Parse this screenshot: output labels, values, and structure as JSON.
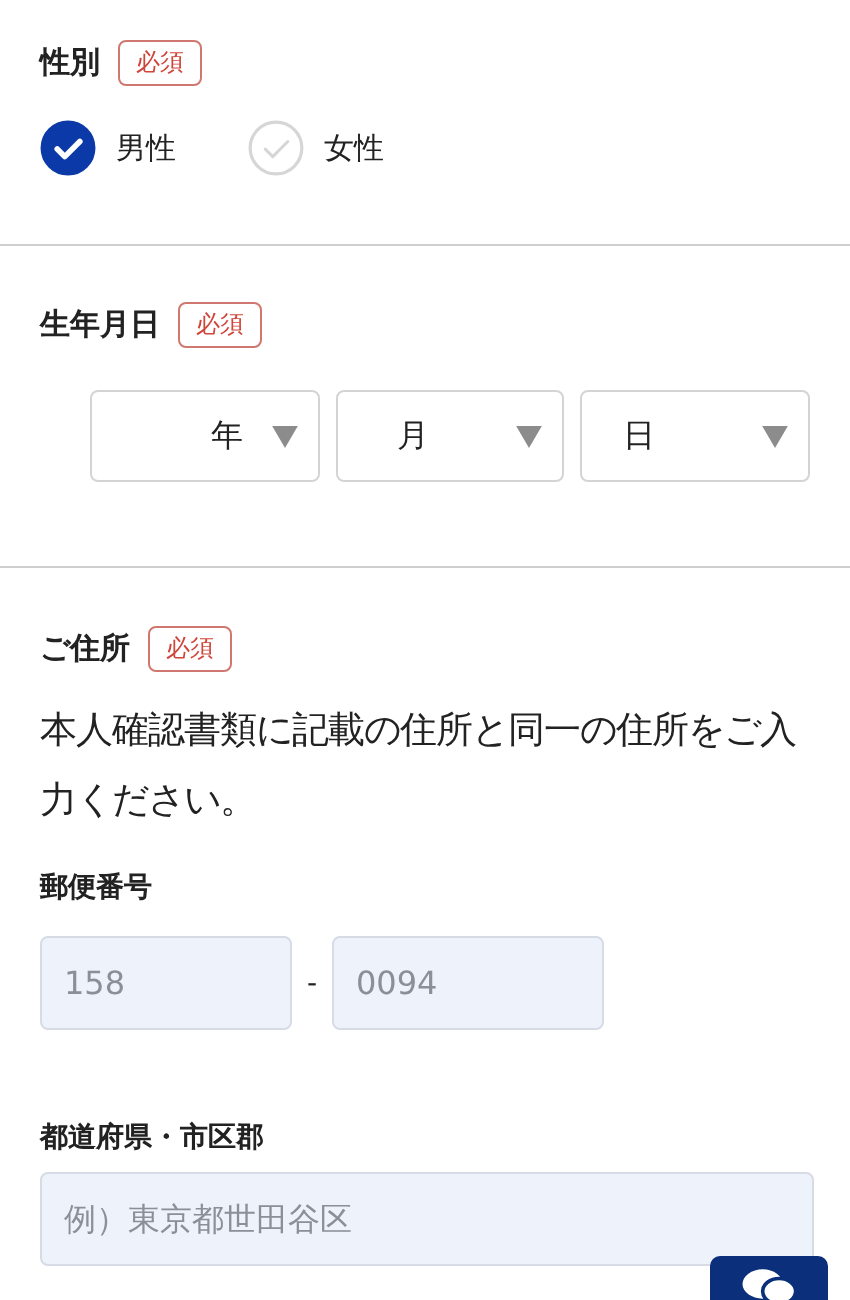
{
  "gender": {
    "label": "性別",
    "required_badge": "必須",
    "options": [
      {
        "label": "男性",
        "selected": true
      },
      {
        "label": "女性",
        "selected": false
      }
    ]
  },
  "birthdate": {
    "label": "生年月日",
    "required_badge": "必須",
    "selects": [
      {
        "label": "年"
      },
      {
        "label": "月"
      },
      {
        "label": "日"
      }
    ]
  },
  "address": {
    "label": "ご住所",
    "required_badge": "必須",
    "note": "本人確認書類に記載の住所と同一の住所をご入力ください。",
    "postal": {
      "label": "郵便番号",
      "first": {
        "placeholder": "158"
      },
      "separator": "-",
      "second": {
        "placeholder": "0094"
      }
    },
    "city": {
      "label": "都道府県・市区郡",
      "placeholder": "例）東京都世田谷区"
    }
  }
}
